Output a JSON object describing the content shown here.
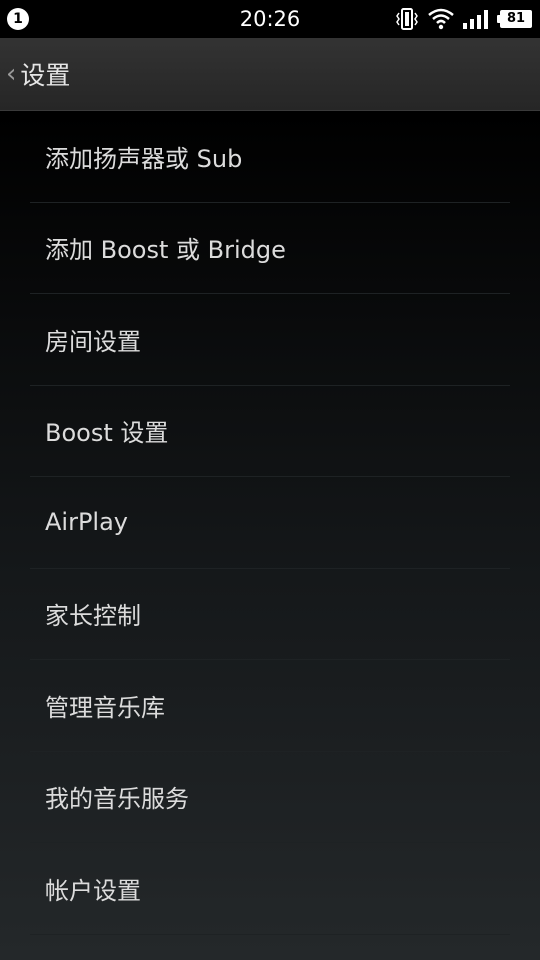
{
  "status_bar": {
    "notification_count": "1",
    "time": "20:26",
    "battery_level": "81"
  },
  "header": {
    "title": "设置"
  },
  "settings": {
    "items": [
      {
        "label": "添加扬声器或 Sub"
      },
      {
        "label": "添加 Boost 或 Bridge"
      },
      {
        "label": "房间设置"
      },
      {
        "label": "Boost 设置"
      },
      {
        "label": "AirPlay"
      },
      {
        "label": "家长控制"
      },
      {
        "label": "管理音乐库"
      },
      {
        "label": "我的音乐服务"
      },
      {
        "label": "帐户设置"
      }
    ]
  },
  "icons": {
    "notification": "notification-count-icon",
    "vibrate": "vibrate-icon",
    "wifi": "wifi-icon",
    "signal": "signal-icon",
    "battery": "battery-icon",
    "back": "back-chevron-icon"
  },
  "colors": {
    "background": "#000000",
    "text": "#dcdcdc",
    "divider": "#1e2224",
    "header_bg": "#2c2c2c"
  }
}
